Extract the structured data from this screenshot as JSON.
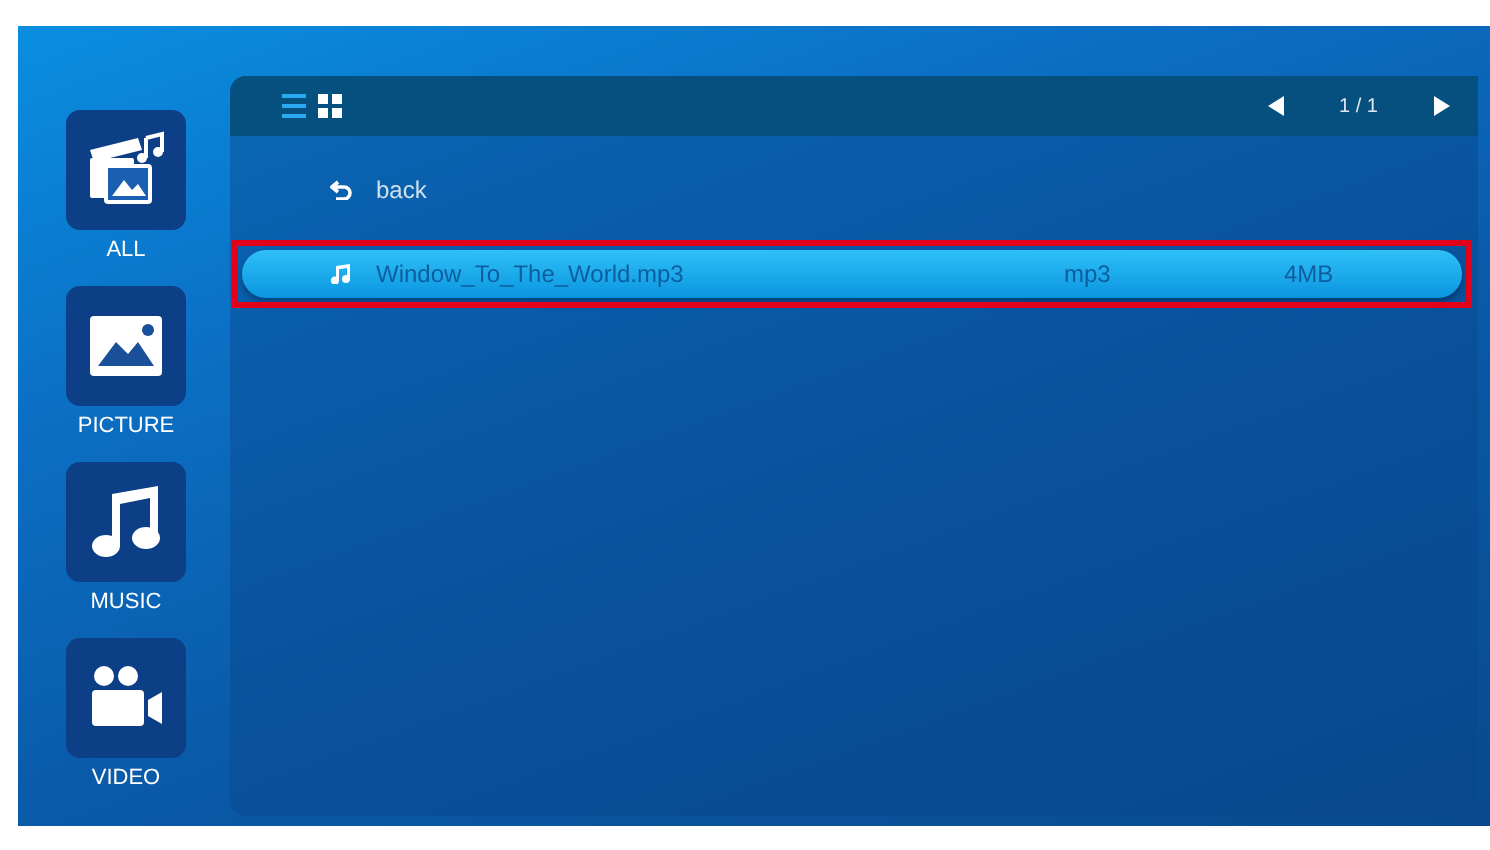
{
  "sidebar": {
    "items": [
      {
        "kind": "all",
        "label": "ALL"
      },
      {
        "kind": "picture",
        "label": "PICTURE"
      },
      {
        "kind": "music",
        "label": "MUSIC"
      },
      {
        "kind": "video",
        "label": "VIDEO"
      }
    ]
  },
  "toolbar": {
    "view_modes": [
      {
        "kind": "list",
        "selected": true
      },
      {
        "kind": "grid",
        "selected": false
      }
    ],
    "page": "1 / 1"
  },
  "files": [
    {
      "kind": "back",
      "name": "back",
      "selected": false,
      "outlined": false
    },
    {
      "kind": "music",
      "name": "Window_To_The_World.mp3",
      "type": "mp3",
      "size": "4MB",
      "selected": true,
      "outlined": true
    }
  ]
}
